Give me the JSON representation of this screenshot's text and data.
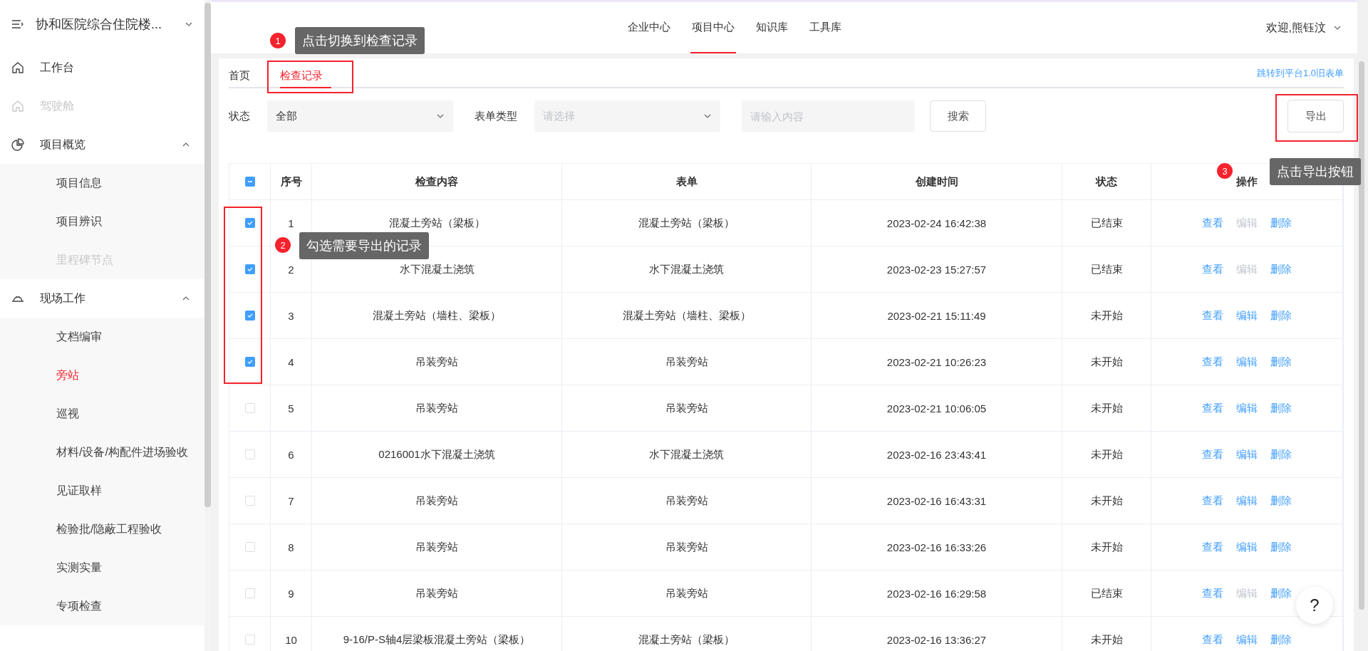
{
  "sidebar": {
    "project": "协和医院综合住院楼...",
    "items": [
      {
        "kind": "link",
        "label": "工作台",
        "disabled": false
      },
      {
        "kind": "link",
        "label": "驾驶舱",
        "disabled": true
      },
      {
        "kind": "group",
        "label": "项目概览",
        "expanded": true,
        "children": [
          {
            "label": "项目信息",
            "selected": false,
            "disabled": false
          },
          {
            "label": "项目辨识",
            "selected": false,
            "disabled": false
          },
          {
            "label": "里程碑节点",
            "selected": false,
            "disabled": true
          }
        ]
      },
      {
        "kind": "group",
        "label": "现场工作",
        "expanded": true,
        "children": [
          {
            "label": "文档编审",
            "selected": false,
            "disabled": false
          },
          {
            "label": "旁站",
            "selected": true,
            "disabled": false
          },
          {
            "label": "巡视",
            "selected": false,
            "disabled": false
          },
          {
            "label": "材料/设备/构配件进场验收",
            "selected": false,
            "disabled": false
          },
          {
            "label": "见证取样",
            "selected": false,
            "disabled": false
          },
          {
            "label": "检验批/隐蔽工程验收",
            "selected": false,
            "disabled": false
          },
          {
            "label": "实测实量",
            "selected": false,
            "disabled": false
          },
          {
            "label": "专项检查",
            "selected": false,
            "disabled": false
          }
        ]
      }
    ]
  },
  "top_nav": {
    "tabs": [
      {
        "label": "企业中心",
        "selected": false
      },
      {
        "label": "项目中心",
        "selected": true
      },
      {
        "label": "知识库",
        "selected": false
      },
      {
        "label": "工具库",
        "selected": false
      }
    ],
    "user": "欢迎,熊钰汶"
  },
  "page_tabs": [
    {
      "label": "首页",
      "selected": false
    },
    {
      "label": "检查记录",
      "selected": true
    }
  ],
  "legacy_link": "跳转到平台1.0旧表单",
  "filters": {
    "status_label": "状态",
    "status_value": "全部",
    "form_type_label": "表单类型",
    "form_type_placeholder": "请选择",
    "search_placeholder": "请输入内容",
    "search_button": "搜索"
  },
  "export_button": "导出",
  "table": {
    "select_all": {
      "indeterminate": true
    },
    "columns": [
      "序号",
      "检查内容",
      "表单",
      "创建时间",
      "状态",
      "操作"
    ],
    "rows": [
      {
        "checked": true,
        "no": "1",
        "content": "混凝土旁站（梁板）",
        "form": "混凝土旁站（梁板）",
        "created": "2023-02-24 16:42:38",
        "status": "已结束",
        "actions": [
          {
            "label": "查看",
            "disabled": false
          },
          {
            "label": "编辑",
            "disabled": true
          },
          {
            "label": "删除",
            "disabled": false
          }
        ]
      },
      {
        "checked": true,
        "no": "2",
        "content": "水下混凝土浇筑",
        "form": "水下混凝土浇筑",
        "created": "2023-02-23 15:27:57",
        "status": "已结束",
        "actions": [
          {
            "label": "查看",
            "disabled": false
          },
          {
            "label": "编辑",
            "disabled": true
          },
          {
            "label": "删除",
            "disabled": false
          }
        ]
      },
      {
        "checked": true,
        "no": "3",
        "content": "混凝土旁站（墙柱、梁板）",
        "form": "混凝土旁站（墙柱、梁板）",
        "created": "2023-02-21 15:11:49",
        "status": "未开始",
        "actions": [
          {
            "label": "查看",
            "disabled": false
          },
          {
            "label": "编辑",
            "disabled": false
          },
          {
            "label": "删除",
            "disabled": false
          }
        ]
      },
      {
        "checked": true,
        "no": "4",
        "content": "吊装旁站",
        "form": "吊装旁站",
        "created": "2023-02-21 10:26:23",
        "status": "未开始",
        "actions": [
          {
            "label": "查看",
            "disabled": false
          },
          {
            "label": "编辑",
            "disabled": false
          },
          {
            "label": "删除",
            "disabled": false
          }
        ]
      },
      {
        "checked": false,
        "no": "5",
        "content": "吊装旁站",
        "form": "吊装旁站",
        "created": "2023-02-21 10:06:05",
        "status": "未开始",
        "actions": [
          {
            "label": "查看",
            "disabled": false
          },
          {
            "label": "编辑",
            "disabled": false
          },
          {
            "label": "删除",
            "disabled": false
          }
        ]
      },
      {
        "checked": false,
        "no": "6",
        "content": "0216001水下混凝土浇筑",
        "form": "水下混凝土浇筑",
        "created": "2023-02-16 23:43:41",
        "status": "未开始",
        "actions": [
          {
            "label": "查看",
            "disabled": false
          },
          {
            "label": "编辑",
            "disabled": false
          },
          {
            "label": "删除",
            "disabled": false
          }
        ]
      },
      {
        "checked": false,
        "no": "7",
        "content": "吊装旁站",
        "form": "吊装旁站",
        "created": "2023-02-16 16:43:31",
        "status": "未开始",
        "actions": [
          {
            "label": "查看",
            "disabled": false
          },
          {
            "label": "编辑",
            "disabled": false
          },
          {
            "label": "删除",
            "disabled": false
          }
        ]
      },
      {
        "checked": false,
        "no": "8",
        "content": "吊装旁站",
        "form": "吊装旁站",
        "created": "2023-02-16 16:33:26",
        "status": "未开始",
        "actions": [
          {
            "label": "查看",
            "disabled": false
          },
          {
            "label": "编辑",
            "disabled": false
          },
          {
            "label": "删除",
            "disabled": false
          }
        ]
      },
      {
        "checked": false,
        "no": "9",
        "content": "吊装旁站",
        "form": "吊装旁站",
        "created": "2023-02-16 16:29:58",
        "status": "已结束",
        "actions": [
          {
            "label": "查看",
            "disabled": false
          },
          {
            "label": "编辑",
            "disabled": true
          },
          {
            "label": "删除",
            "disabled": false
          }
        ]
      },
      {
        "checked": false,
        "no": "10",
        "content": "9-16/P-S轴4层梁板混凝土旁站（梁板）",
        "form": "混凝土旁站（梁板）",
        "created": "2023-02-16 13:36:27",
        "status": "未开始",
        "actions": [
          {
            "label": "查看",
            "disabled": false
          },
          {
            "label": "编辑",
            "disabled": false
          },
          {
            "label": "删除",
            "disabled": false
          }
        ]
      }
    ]
  },
  "annotations": [
    {
      "number": "1",
      "text": "点击切换到检查记录"
    },
    {
      "number": "2",
      "text": "勾选需要导出的记录"
    },
    {
      "number": "3",
      "text": "点击导出按钮"
    }
  ],
  "help_button": "?"
}
